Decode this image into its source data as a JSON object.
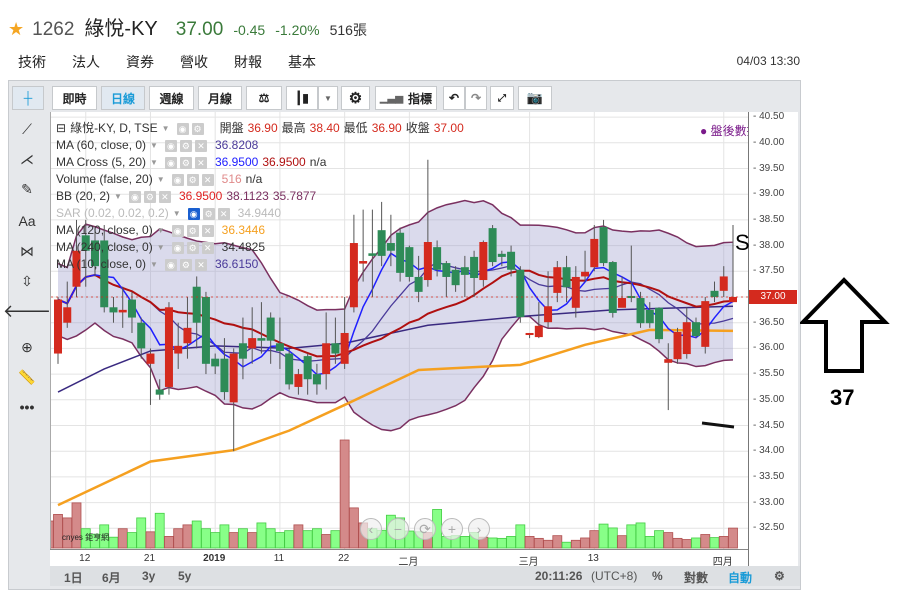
{
  "header": {
    "code": "1262",
    "name": "綠悅-KY",
    "price": "37.00",
    "change": "-0.45",
    "change_pct": "-1.20%",
    "volume": "516張"
  },
  "tabs": [
    {
      "label": "技術",
      "active": true
    },
    {
      "label": "法人"
    },
    {
      "label": "資券"
    },
    {
      "label": "營收"
    },
    {
      "label": "財報"
    },
    {
      "label": "基本"
    }
  ],
  "datetime": "04/03 13:30",
  "toolbar": {
    "realtime": "即時",
    "daily": "日線",
    "weekly": "週線",
    "monthly": "月線",
    "indicators": "指標"
  },
  "legend": {
    "title": "綠悅-KY, D, TSE",
    "open_label": "開盤",
    "open": "36.90",
    "high_label": "最高",
    "high": "38.40",
    "low_label": "最低",
    "low": "36.90",
    "close_label": "收盤",
    "close": "37.00",
    "after_hours": "盤後數據",
    "rows": [
      {
        "name": "MA (60, close, 0)",
        "values": [
          "36.8208"
        ],
        "colors": [
          "#4a3a9a"
        ]
      },
      {
        "name": "MA Cross (5, 20)",
        "values": [
          "36.9500",
          "36.9500",
          "n/a"
        ],
        "colors": [
          "#2020ff",
          "#b01010",
          "#333"
        ]
      },
      {
        "name": "Volume (false, 20)",
        "values": [
          "516",
          "n/a"
        ],
        "colors": [
          "#e08a8a",
          "#333"
        ]
      },
      {
        "name": "BB (20, 2)",
        "values": [
          "36.9500",
          "38.1123",
          "35.7877"
        ],
        "colors": [
          "#e02020",
          "#7a3060",
          "#7a3060"
        ]
      },
      {
        "name": "SAR (0.02, 0.02, 0.2)",
        "values": [
          "34.9440"
        ],
        "colors": [
          "#bbb"
        ]
      },
      {
        "name": "MA (120, close, 0)",
        "values": [
          "36.3446"
        ],
        "colors": [
          "#f5a020"
        ]
      },
      {
        "name": "MA (240, close, 0)",
        "values": [
          "34.4825"
        ],
        "colors": [
          "#333"
        ]
      },
      {
        "name": "MA (10, close, 0)",
        "values": [
          "36.6150"
        ],
        "colors": [
          "#4a3a9a"
        ]
      }
    ]
  },
  "bottom": {
    "ranges": [
      "1日",
      "6月",
      "3y",
      "5y"
    ],
    "clock": "20:11:26",
    "tz": "(UTC+8)",
    "pct": "%",
    "log": "對數",
    "auto": "自動"
  },
  "nav": {
    "prev": "‹",
    "zoom_out": "−",
    "reset": "⟳",
    "zoom_in": "+",
    "next": "›"
  },
  "logo": "cnyes 鉅亨網",
  "annotations": {
    "s_mark": "S",
    "arrow_label": "37"
  },
  "colors": {
    "up": "#d42a1e",
    "down": "#2e8b57",
    "vol_up": "#d48a8a",
    "vol_down": "#88ff88",
    "ma5": "#2020ff",
    "ma20": "#b01010",
    "bb": "#7a3060",
    "ma10": "#4a3a9a",
    "ma60": "#3a2a80",
    "ma120": "#f5a020"
  },
  "chart_data": {
    "type": "candlestick",
    "ylim": [
      32.2,
      40.6
    ],
    "yticks": [
      "40.50",
      "40.00",
      "39.50",
      "39.00",
      "38.50",
      "38.00",
      "37.50",
      "37.00",
      "36.50",
      "36.00",
      "35.50",
      "35.00",
      "34.50",
      "34.00",
      "33.50",
      "33.00",
      "32.50"
    ],
    "last_price": "37.00",
    "xticks": [
      {
        "i": 3,
        "label": "12"
      },
      {
        "i": 10,
        "label": "21"
      },
      {
        "i": 17,
        "label": "2019"
      },
      {
        "i": 24,
        "label": "11"
      },
      {
        "i": 31,
        "label": "22"
      },
      {
        "i": 38,
        "label": "二月"
      },
      {
        "i": 51,
        "label": "三月"
      },
      {
        "i": 58,
        "label": "13"
      },
      {
        "i": 72,
        "label": "四月"
      }
    ],
    "candles": [
      [
        35.9,
        37.0,
        35.7,
        36.95
      ],
      [
        36.5,
        37.3,
        36.4,
        36.8
      ],
      [
        37.2,
        38.5,
        37.0,
        37.9
      ],
      [
        38.2,
        38.5,
        37.2,
        37.9
      ],
      [
        38.1,
        38.3,
        37.4,
        37.6
      ],
      [
        38.1,
        38.4,
        36.7,
        36.8
      ],
      [
        36.8,
        37.0,
        36.5,
        36.7
      ],
      [
        36.7,
        37.2,
        36.4,
        36.75
      ],
      [
        36.95,
        37.1,
        36.3,
        36.6
      ],
      [
        36.5,
        36.6,
        35.8,
        36.0
      ],
      [
        35.7,
        36.0,
        34.9,
        35.9
      ],
      [
        35.2,
        35.4,
        35.0,
        35.1
      ],
      [
        35.25,
        36.9,
        35.1,
        36.8
      ],
      [
        35.9,
        36.5,
        35.6,
        36.05
      ],
      [
        36.1,
        37.0,
        35.8,
        36.4
      ],
      [
        37.2,
        37.4,
        36.0,
        36.5
      ],
      [
        37.0,
        37.1,
        35.5,
        35.7
      ],
      [
        35.8,
        35.9,
        35.5,
        35.65
      ],
      [
        35.8,
        36.2,
        35.0,
        35.15
      ],
      [
        34.95,
        36.0,
        34.0,
        35.9
      ],
      [
        36.1,
        36.6,
        35.4,
        35.8
      ],
      [
        36.0,
        36.8,
        35.7,
        36.2
      ],
      [
        36.2,
        36.9,
        35.9,
        36.15
      ],
      [
        36.6,
        36.7,
        35.7,
        36.15
      ],
      [
        36.1,
        36.6,
        35.6,
        35.95
      ],
      [
        35.9,
        36.0,
        35.2,
        35.3
      ],
      [
        35.25,
        35.6,
        35.1,
        35.5
      ],
      [
        35.85,
        35.9,
        35.1,
        35.4
      ],
      [
        35.5,
        35.7,
        35.1,
        35.3
      ],
      [
        35.5,
        36.7,
        35.2,
        36.1
      ],
      [
        36.1,
        36.6,
        35.7,
        35.9
      ],
      [
        35.7,
        37.0,
        35.6,
        36.3
      ],
      [
        36.8,
        38.6,
        36.7,
        38.05
      ],
      [
        37.65,
        38.7,
        37.3,
        37.7
      ],
      [
        37.85,
        38.7,
        37.0,
        37.8
      ],
      [
        38.3,
        38.85,
        37.6,
        37.8
      ],
      [
        38.05,
        38.6,
        37.6,
        37.9
      ],
      [
        38.25,
        38.35,
        37.3,
        37.47
      ],
      [
        37.97,
        38.0,
        37.3,
        37.39
      ],
      [
        37.39,
        37.8,
        36.9,
        37.1
      ],
      [
        37.33,
        39.67,
        37.2,
        38.07
      ],
      [
        37.97,
        38.1,
        37.4,
        37.53
      ],
      [
        37.66,
        37.7,
        37.0,
        37.39
      ],
      [
        37.53,
        37.6,
        37.1,
        37.23
      ],
      [
        37.58,
        37.8,
        37.0,
        37.43
      ],
      [
        37.78,
        37.9,
        37.0,
        37.37
      ],
      [
        37.33,
        38.1,
        37.2,
        38.07
      ],
      [
        38.34,
        38.4,
        37.6,
        37.68
      ],
      [
        37.84,
        37.9,
        37.6,
        37.78
      ],
      [
        37.88,
        38.0,
        37.4,
        37.53
      ],
      [
        37.53,
        37.6,
        36.5,
        36.61
      ],
      [
        36.26,
        36.3,
        36.2,
        36.3
      ],
      [
        36.22,
        36.9,
        36.2,
        36.44
      ],
      [
        36.51,
        37.5,
        36.4,
        36.82
      ],
      [
        37.08,
        37.7,
        36.9,
        37.58
      ],
      [
        37.58,
        37.8,
        36.9,
        37.19
      ],
      [
        36.79,
        37.6,
        36.6,
        37.39
      ],
      [
        37.4,
        37.9,
        37.3,
        37.49
      ],
      [
        37.58,
        38.4,
        37.5,
        38.13
      ],
      [
        38.36,
        38.5,
        37.6,
        37.66
      ],
      [
        37.68,
        37.7,
        36.6,
        36.69
      ],
      [
        36.79,
        37.4,
        36.8,
        36.98
      ],
      [
        37.02,
        38.0,
        36.9,
        36.98
      ],
      [
        36.98,
        37.1,
        36.4,
        36.49
      ],
      [
        36.75,
        36.9,
        36.4,
        36.49
      ],
      [
        36.79,
        36.8,
        36.1,
        36.18
      ],
      [
        35.72,
        36.1,
        34.8,
        35.79
      ],
      [
        35.79,
        36.4,
        35.7,
        36.32
      ],
      [
        35.89,
        36.8,
        35.8,
        36.51
      ],
      [
        36.51,
        36.6,
        36.2,
        36.24
      ],
      [
        36.03,
        37.0,
        35.9,
        36.92
      ],
      [
        37.12,
        37.3,
        36.9,
        37.0
      ],
      [
        37.12,
        37.6,
        37.0,
        37.4
      ],
      [
        36.9,
        38.4,
        36.9,
        37.0
      ]
    ],
    "volumes": [
      700,
      870,
      780,
      1170,
      500,
      360,
      600,
      280,
      500,
      400,
      780,
      420,
      900,
      300,
      500,
      600,
      700,
      500,
      400,
      600,
      400,
      500,
      400,
      650,
      500,
      400,
      450,
      600,
      450,
      500,
      350,
      450,
      2800,
      1040,
      650,
      500,
      460,
      850,
      780,
      440,
      420,
      400,
      1000,
      300,
      320,
      300,
      400,
      280,
      260,
      250,
      300,
      600,
      300,
      250,
      200,
      320,
      150,
      200,
      260,
      450,
      620,
      520,
      320,
      600,
      650,
      300,
      450,
      400,
      250,
      220,
      260,
      350,
      270,
      300,
      516
    ],
    "ma60": [
      [
        0,
        35.15
      ],
      [
        5,
        35.6
      ],
      [
        10,
        35.95
      ],
      [
        17,
        36.05
      ],
      [
        25,
        36.0
      ],
      [
        31,
        36.1
      ],
      [
        40,
        36.45
      ],
      [
        50,
        36.62
      ],
      [
        60,
        36.75
      ],
      [
        73,
        36.82
      ]
    ],
    "ma120": [
      [
        0,
        32.95
      ],
      [
        10,
        33.8
      ],
      [
        19,
        34.02
      ],
      [
        25,
        34.4
      ],
      [
        31,
        34.9
      ],
      [
        39,
        35.58
      ],
      [
        50,
        35.68
      ],
      [
        57,
        36.07
      ],
      [
        64,
        36.36
      ],
      [
        73,
        36.34
      ]
    ]
  }
}
